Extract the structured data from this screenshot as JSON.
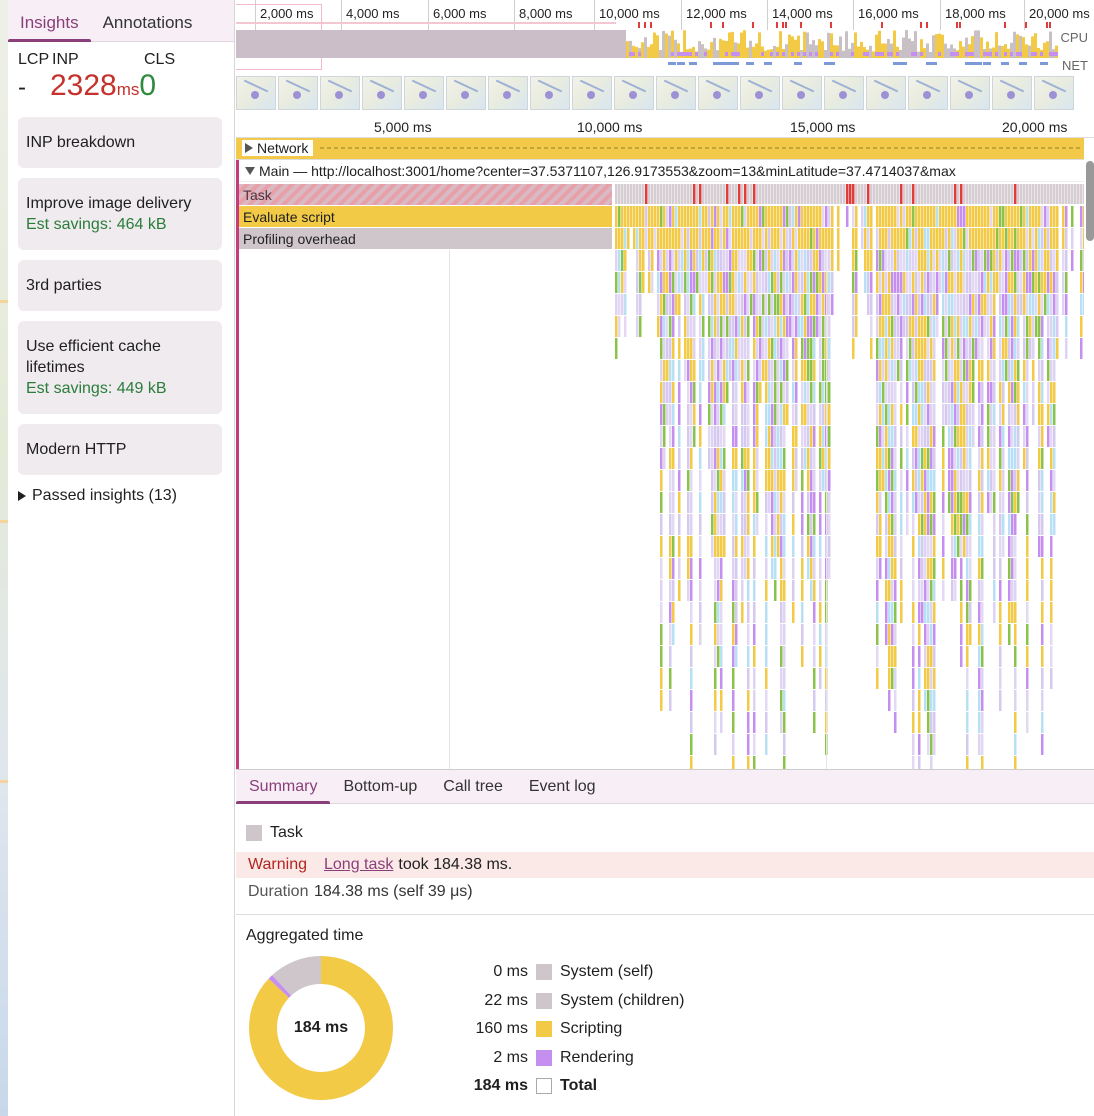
{
  "colors": {
    "accent": "#8a3f7a",
    "bad": "#c5322e",
    "good": "#2e8b3e",
    "scripting": "#f2ca46",
    "system": "#cfc6cb",
    "rendering": "#c58ff0",
    "painting": "#8bc34a"
  },
  "sidebar": {
    "tabs": [
      {
        "label": "Insights",
        "active": true
      },
      {
        "label": "Annotations",
        "active": false
      }
    ],
    "metrics": {
      "lcp_label": "LCP",
      "inp_label": "INP",
      "cls_label": "CLS",
      "lcp_value": "-",
      "inp_value": "2328",
      "inp_unit": "ms",
      "cls_value": "0"
    },
    "insights": [
      {
        "title": "INP breakdown",
        "savings": ""
      },
      {
        "title": "Improve image delivery",
        "savings": "Est savings: 464 kB"
      },
      {
        "title": "3rd parties",
        "savings": ""
      },
      {
        "title": "Use efficient cache lifetimes",
        "savings": "Est savings: 449 kB"
      },
      {
        "title": "Modern HTTP",
        "savings": ""
      }
    ],
    "passed": "Passed insights (13)"
  },
  "overview": {
    "ticks": [
      "2,000 ms",
      "4,000 ms",
      "6,000 ms",
      "8,000 ms",
      "10,000 ms",
      "12,000 ms",
      "14,000 ms",
      "16,000 ms",
      "18,000 ms",
      "20,000 ms"
    ],
    "cpu_label": "CPU",
    "net_label": "NET",
    "thumbnail_count": 20
  },
  "ruler": {
    "ticks": [
      "5,000 ms",
      "10,000 ms",
      "15,000 ms",
      "20,000 ms"
    ]
  },
  "tracks": {
    "network_label": "Network",
    "main_label": "Main — http://localhost:3001/home?center=37.5371107,126.9173553&zoom=13&minLatitude=37.4714037&max",
    "rows": [
      "Task",
      "Evaluate script",
      "Profiling overhead"
    ]
  },
  "details": {
    "tabs": [
      {
        "label": "Summary",
        "active": true
      },
      {
        "label": "Bottom-up",
        "active": false
      },
      {
        "label": "Call tree",
        "active": false
      },
      {
        "label": "Event log",
        "active": false
      }
    ],
    "title": "Task",
    "warning_label": "Warning",
    "warning_link": "Long task",
    "warning_text": "took 184.38 ms.",
    "duration_label": "Duration",
    "duration_value": "184.38 ms (self 39 μs)",
    "aggregated_title": "Aggregated time",
    "donut_center": "184 ms",
    "aggregated": [
      {
        "value": "0 ms",
        "label": "System (self)",
        "ms": 0,
        "color": "#cfc6cb"
      },
      {
        "value": "22 ms",
        "label": "System (children)",
        "ms": 22,
        "color": "#cfc6cb"
      },
      {
        "value": "160 ms",
        "label": "Scripting",
        "ms": 160,
        "color": "#f2ca46"
      },
      {
        "value": "2 ms",
        "label": "Rendering",
        "ms": 2,
        "color": "#c58ff0"
      }
    ],
    "total": {
      "value": "184 ms",
      "label": "Total"
    }
  }
}
